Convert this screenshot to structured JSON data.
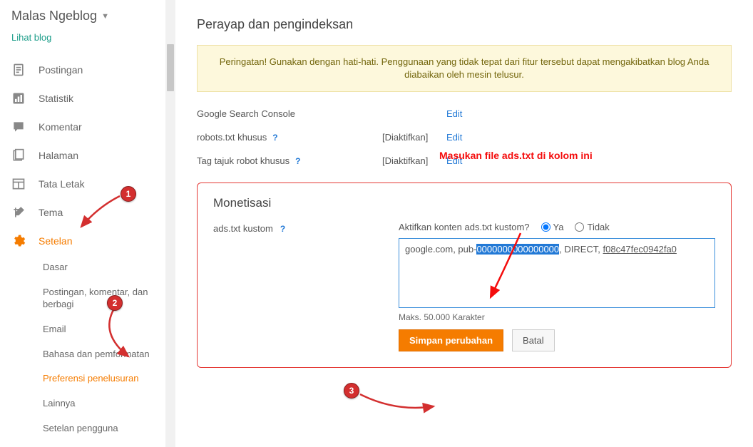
{
  "header": {
    "blog_title": "Malas Ngeblog",
    "view_blog": "Lihat blog"
  },
  "sidebar": {
    "items": [
      {
        "label": "Postingan",
        "icon": "document-icon"
      },
      {
        "label": "Statistik",
        "icon": "stats-icon"
      },
      {
        "label": "Komentar",
        "icon": "comment-icon"
      },
      {
        "label": "Halaman",
        "icon": "page-icon"
      },
      {
        "label": "Tata Letak",
        "icon": "layout-icon"
      },
      {
        "label": "Tema",
        "icon": "theme-icon"
      },
      {
        "label": "Setelan",
        "icon": "gear-icon"
      }
    ],
    "subitems": [
      {
        "label": "Dasar"
      },
      {
        "label": "Postingan, komentar, dan berbagi"
      },
      {
        "label": "Email"
      },
      {
        "label": "Bahasa dan pemformatan"
      },
      {
        "label": "Preferensi penelusuran"
      },
      {
        "label": "Lainnya"
      },
      {
        "label": "Setelan pengguna"
      }
    ]
  },
  "main": {
    "section_title": "Perayap dan pengindeksan",
    "warning": "Peringatan! Gunakan dengan hati-hati. Penggunaan yang tidak tepat dari fitur tersebut dapat mengakibatkan blog Anda diabaikan oleh mesin telusur.",
    "rows": [
      {
        "label": "Google Search Console",
        "status": "",
        "edit": "Edit"
      },
      {
        "label": "robots.txt khusus",
        "status": "[Diaktifkan]",
        "edit": "Edit"
      },
      {
        "label": "Tag tajuk robot khusus",
        "status": "[Diaktifkan]",
        "edit": "Edit"
      }
    ]
  },
  "monetize": {
    "title": "Monetisasi",
    "ads_label": "ads.txt kustom",
    "activate_label": "Aktifkan konten ads.txt kustom?",
    "radio_yes": "Ya",
    "radio_no": "Tidak",
    "textarea_prefix": "google.com, pub-",
    "textarea_highlight": "0000000000000000",
    "textarea_mid": ", DIRECT, ",
    "textarea_underline": "f08c47fec0942fa0",
    "maxchar": "Maks. 50.000 Karakter",
    "btn_save": "Simpan perubahan",
    "btn_cancel": "Batal"
  },
  "annotations": {
    "badge1": "1",
    "badge2": "2",
    "badge3": "3",
    "text": "Masukan file ads.txt di kolom ini"
  }
}
